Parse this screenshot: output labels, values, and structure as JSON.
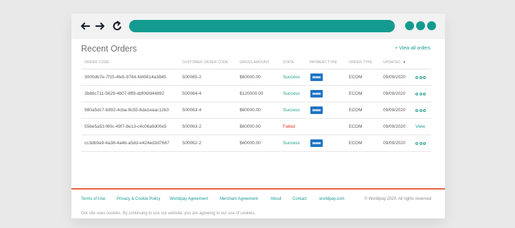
{
  "browser": {
    "icons": [
      "back-arrow-icon",
      "forward-arrow-icon",
      "refresh-icon"
    ],
    "url_bar_color": "#139b8f"
  },
  "page": {
    "title": "Recent Orders",
    "view_all_link": "+ View all orders"
  },
  "table": {
    "headers": {
      "order_code": "ORDER CODE",
      "customer_order_code": "CUSTOMER ORDER CODE",
      "gross_amount": "GROSS AMOUNT",
      "state": "STATE",
      "payment_type": "PAYMENT TYPE",
      "order_type": "ORDER TYPE",
      "updated": "UPDATED"
    },
    "sort_indicator": "▾",
    "rows": [
      {
        "order_code": "3000db7e-7f15-4fe5-9784-fd45614a3845",
        "customer_order_code": "S00065-2",
        "gross_amount": "$60000.00",
        "state": "Success",
        "has_payment_icon": true,
        "order_type": "ECOM",
        "updated": "09/09/2020",
        "action": "dots"
      },
      {
        "order_code": "3b86c711-5629-4b07-8ff9-ddf06fd44892",
        "customer_order_code": "S00064-4",
        "gross_amount": "$120000.00",
        "state": "Success",
        "has_payment_icon": true,
        "order_type": "ECOM",
        "updated": "09/09/2020",
        "action": "dots"
      },
      {
        "order_code": "980a5dc7-b892-4cba-9c55-8da1eaac12b3",
        "customer_order_code": "S00063-4",
        "gross_amount": "$60000.00",
        "state": "Success",
        "has_payment_icon": true,
        "order_type": "ECOM",
        "updated": "09/09/2020",
        "action": "dots"
      },
      {
        "order_code": "556e5a53-f60c-49f7-8e13-c4c06a9d00e5",
        "customer_order_code": "S00063-2",
        "gross_amount": "$60000.00",
        "state": "Failed",
        "has_payment_icon": false,
        "order_type": "ECOM",
        "updated": "09/09/2020",
        "action": "View"
      },
      {
        "order_code": "cc3db9a9-4a38-4a4b-a5dd-e424ed3d7667",
        "customer_order_code": "S00062-2",
        "gross_amount": "$60000.00",
        "state": "Success",
        "has_payment_icon": true,
        "order_type": "ECOM",
        "updated": "09/09/2020",
        "action": "dots"
      }
    ]
  },
  "footer": {
    "links": [
      "Terms of Use",
      "Privacy & Cookie Policy",
      "Worldpay Agreement",
      "Merchant Agreement",
      "About",
      "Contact",
      "worldpay.com"
    ],
    "copyright": "© Worldpay 2020. All rights reserved",
    "cookie_notice": "Our site uses cookies. By continuing to use our website, you are agreeing to our use of cookies."
  },
  "colors": {
    "accent": "#139b8f",
    "success": "#1a9a8a",
    "failed": "#e0342a",
    "payment_badge": "#1f74c4",
    "footer_rule": "#e8623b"
  }
}
